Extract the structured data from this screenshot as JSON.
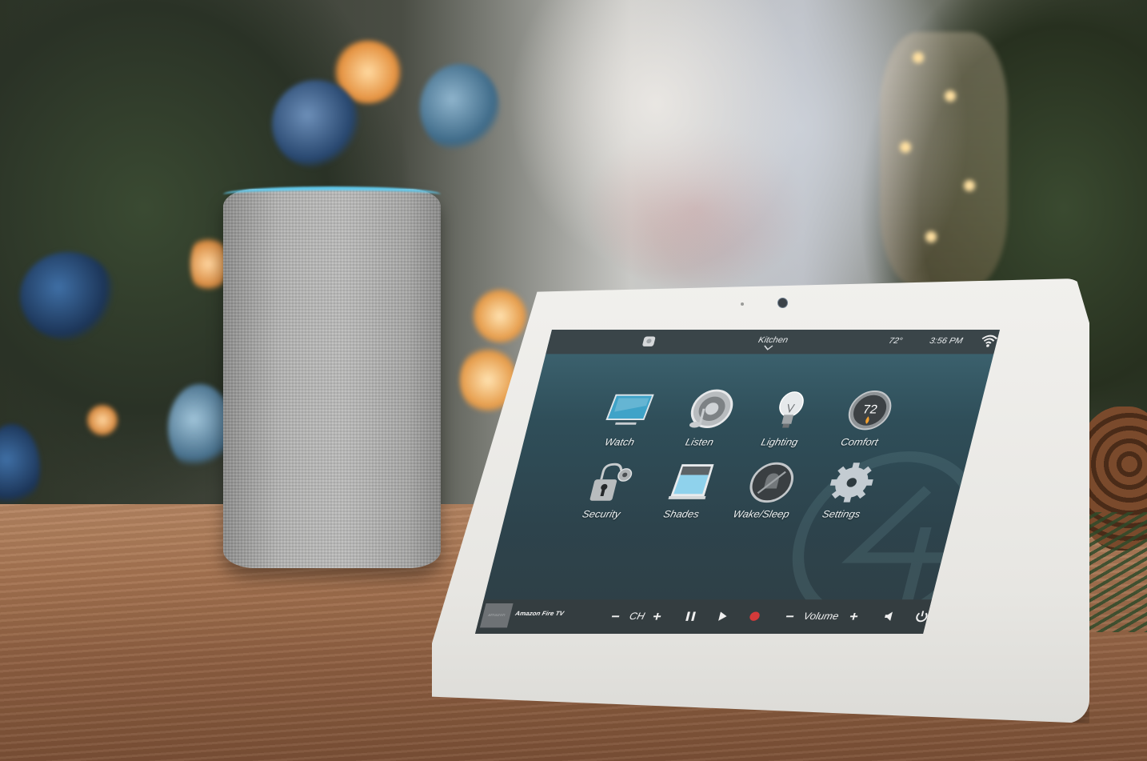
{
  "device": {
    "type": "in-wall touch panel",
    "speaker_ring_color": "#62c8ea"
  },
  "topbar": {
    "remote_icon": "remote-icon",
    "room": "Kitchen",
    "room_chevron": "chevron-down-icon",
    "temperature": "72°",
    "time": "3:56 PM",
    "wifi_icon": "wifi-icon",
    "battery_icon": "battery-charging-icon"
  },
  "tiles": [
    {
      "label": "Watch",
      "icon": "tv-icon"
    },
    {
      "label": "Listen",
      "icon": "speaker-music-icon"
    },
    {
      "label": "Lighting",
      "icon": "light-bulb-icon"
    },
    {
      "label": "Comfort",
      "icon": "thermostat-icon",
      "value": "72"
    },
    {
      "label": "Security",
      "icon": "padlock-camera-icon"
    },
    {
      "label": "Shades",
      "icon": "window-shade-icon"
    },
    {
      "label": "Wake/Sleep",
      "icon": "bell-muted-icon"
    },
    {
      "label": "Settings",
      "icon": "gear-icon"
    }
  ],
  "bottombar": {
    "source_thumb": "amazon",
    "source_name": "Amazon Fire TV",
    "ch_minus": "−",
    "ch_label": "CH",
    "ch_plus": "+",
    "pause": "pause-icon",
    "play": "play-icon",
    "record": "record-icon",
    "record_color": "#d43a3a",
    "vol_minus": "−",
    "vol_label": "Volume",
    "vol_plus": "+",
    "mute": "mute-icon",
    "power": "power-icon",
    "home": "home-icon"
  }
}
